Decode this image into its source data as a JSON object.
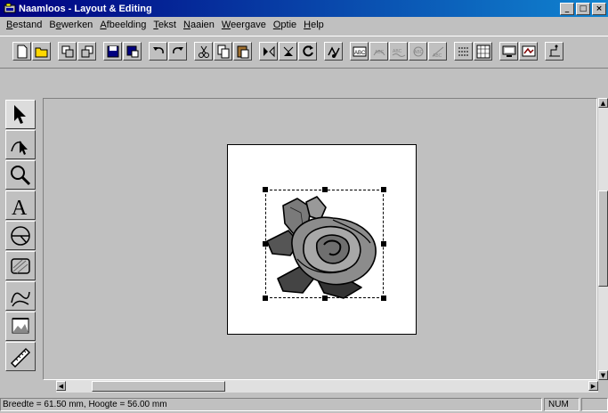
{
  "window": {
    "title": "Naamloos - Layout & Editing",
    "controls": [
      "_",
      "□",
      "×"
    ]
  },
  "menu": [
    {
      "label": "Bestand",
      "accel_index": 0
    },
    {
      "label": "Bewerken",
      "accel_index": 1
    },
    {
      "label": "Afbeelding",
      "accel_index": 0
    },
    {
      "label": "Tekst",
      "accel_index": 0
    },
    {
      "label": "Naaien",
      "accel_index": 0
    },
    {
      "label": "Weergave",
      "accel_index": 0
    },
    {
      "label": "Optie",
      "accel_index": 0
    },
    {
      "label": "Help",
      "accel_index": 0
    }
  ],
  "toolbar": {
    "buttons": [
      "new-file-icon",
      "open-folder-icon",
      "import-icon",
      "export-icon",
      "save-icon",
      "save-as-icon",
      "undo-icon",
      "redo-icon",
      "cut-icon",
      "copy-icon",
      "paste-icon",
      "mirror-icon",
      "flip-icon",
      "rotate-icon",
      "stitch-view-icon",
      "text-abc-icon",
      "text-arc-icon",
      "text-wave-icon",
      "text-circle-icon",
      "text-slope-icon",
      "pattern-icon",
      "grid-icon",
      "display-icon",
      "realistic-view-icon",
      "sewing-order-icon"
    ]
  },
  "tools": [
    {
      "name": "select-tool",
      "icon": "arrow-icon",
      "active": true
    },
    {
      "name": "point-edit-tool",
      "icon": "point-edit-icon"
    },
    {
      "name": "zoom-tool",
      "icon": "magnifier-icon"
    },
    {
      "name": "text-tool",
      "icon": "text-a-icon",
      "glyph": "A"
    },
    {
      "name": "shape-tool",
      "icon": "shape-icon"
    },
    {
      "name": "rectangle-tool",
      "icon": "rectangle-icon"
    },
    {
      "name": "stitch-tool",
      "icon": "stitch-icon"
    },
    {
      "name": "image-tool",
      "icon": "image-icon"
    },
    {
      "name": "measure-tool",
      "icon": "ruler-icon"
    }
  ],
  "status": {
    "text": "Breedte  = 61.50 mm, Hoogte = 56.00 mm",
    "num": "NUM"
  },
  "colors": {
    "title_start": "#000080",
    "title_end": "#1084d0",
    "face": "#c0c0c0",
    "page": "#ffffff"
  }
}
